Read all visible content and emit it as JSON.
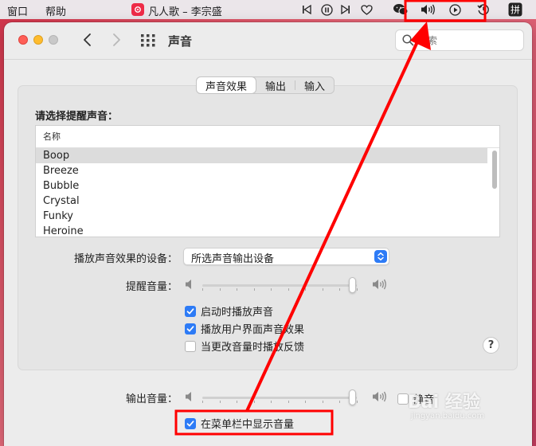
{
  "menubar": {
    "menus": [
      "窗口",
      "帮助"
    ],
    "now_playing": "凡人歌 – 李宗盛"
  },
  "window": {
    "title": "声音",
    "search_placeholder": "搜索"
  },
  "tabs": [
    {
      "label": "声音效果",
      "active": true
    },
    {
      "label": "输出",
      "active": false
    },
    {
      "label": "输入",
      "active": false
    }
  ],
  "alert": {
    "section_label": "请选择提醒声音：",
    "column_header": "名称",
    "sounds": [
      "Boop",
      "Breeze",
      "Bubble",
      "Crystal",
      "Funky",
      "Heroine"
    ],
    "selected": "Boop",
    "device_label": "播放声音效果的设备：",
    "device_value": "所选声音输出设备",
    "volume_label": "提醒音量：",
    "volume": 0.97
  },
  "options": [
    {
      "label": "启动时播放声音",
      "checked": true
    },
    {
      "label": "播放用户界面声音效果",
      "checked": true
    },
    {
      "label": "当更改音量时播放反馈",
      "checked": false
    }
  ],
  "output": {
    "volume_label": "输出音量：",
    "volume": 0.97,
    "mute_label": "静音",
    "muted": false,
    "show_in_menubar_label": "在菜单栏中显示音量",
    "show_in_menubar": true
  },
  "help_label": "?",
  "watermark": {
    "brand": "Bai 经验",
    "url": "jingyan.baidu.com"
  },
  "colors": {
    "accent": "#2d7bf6",
    "annotation": "#ff0000"
  }
}
